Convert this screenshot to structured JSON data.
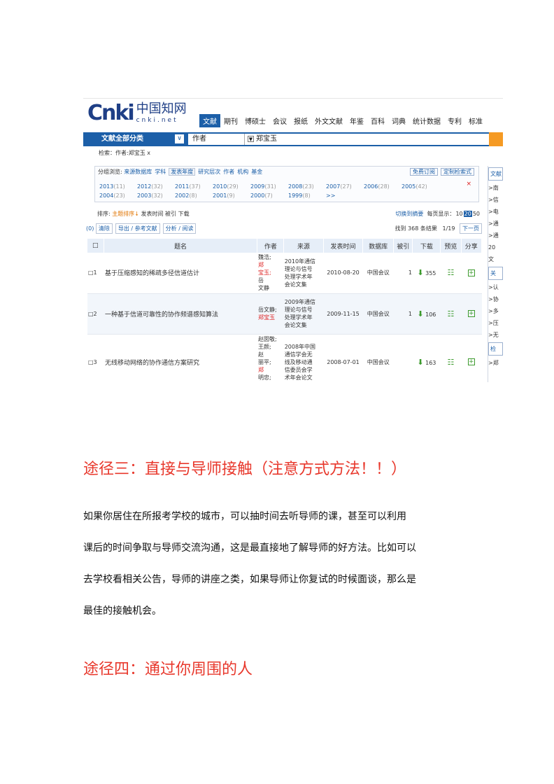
{
  "screenshot": {
    "logo": {
      "latin": "Cnki",
      "chinese": "中国知网",
      "url": "cnki.net"
    },
    "top_tabs": [
      "文献",
      "期刊",
      "博硕士",
      "会议",
      "报纸",
      "外文文献",
      "年鉴",
      "百科",
      "词典",
      "统计数据",
      "专利",
      "标准"
    ],
    "active_tab": "文献",
    "search": {
      "category": "文献全部分类",
      "field": "作者",
      "value": "郑宝玉"
    },
    "crumb": "检索：作者:郑宝玉  x",
    "group_browse": {
      "label": "分组浏览:",
      "options": [
        "来源数据库",
        "学科",
        "发表年度",
        "研究层次",
        "作者",
        "机构",
        "基金"
      ],
      "active": "发表年度",
      "right_buttons": [
        "免费订阅",
        "定制检索式"
      ]
    },
    "years_row1": [
      "2013(11)",
      "2012(32)",
      "2011(37)",
      "2010(29)",
      "2009(31)",
      "2008(23)",
      "2007(27)",
      "2006(28)",
      "2005(42)"
    ],
    "years_row2": [
      "2004(23)",
      "2003(32)",
      "2002(8)",
      "2001(9)",
      "2000(7)",
      "1999(8)",
      ">>"
    ],
    "close": "×",
    "sort": {
      "label": "排序:",
      "active": "主题排序",
      "arrow": "↓",
      "others": [
        "发表时间",
        "被引",
        "下载"
      ],
      "switch": "切换到摘要",
      "per_page_label": "每页显示：",
      "per_page": [
        "10",
        "20",
        "50"
      ],
      "per_page_active": "20"
    },
    "actions": {
      "count": "(0)",
      "buttons": [
        "清除",
        "导出 / 参考文献",
        "分析 / 阅读"
      ],
      "found": "找到 368 条结果",
      "page": "1/19",
      "next": "下一页"
    },
    "columns": [
      "题名",
      "作者",
      "来源",
      "发表时间",
      "数据库",
      "被引",
      "下载",
      "预览",
      "分享"
    ],
    "rows": [
      {
        "num": "1",
        "title": "基于压缩感知的稀疏多径信道估计",
        "authors": [
          "魏浩;",
          "郑",
          "宝玉;",
          "岳",
          "文静"
        ],
        "source": [
          "2010年通信",
          "理论与信号",
          "处理学术年",
          "会论文集"
        ],
        "date": "2010-08-20",
        "db": "中国会议",
        "cited": "1",
        "downloads": "355"
      },
      {
        "num": "2",
        "title": "一种基于信道可靠性的协作频谱感知算法",
        "authors": [
          "岳文静;",
          "郑宝玉"
        ],
        "source": [
          "2009年通信",
          "理论与信号",
          "处理学术年",
          "会论文集"
        ],
        "date": "2009-11-15",
        "db": "中国会议",
        "cited": "1",
        "downloads": "106"
      },
      {
        "num": "3",
        "title": "无线移动网络的协作通信方案研究",
        "authors": [
          "赵囡敬;",
          "王颜;",
          "赵",
          "丽平;",
          "郑",
          "明忠;",
          "郑"
        ],
        "source": [
          "2008年中国",
          "通信学会无",
          "线及移动通",
          "信委员会学",
          "术年会论文"
        ],
        "date": "2008-07-01",
        "db": "中国会议",
        "cited": "",
        "downloads": "163"
      }
    ],
    "sidebar": [
      "文献",
      ">南",
      ">信",
      ">电",
      ">通",
      ">通",
      "20",
      "文",
      "关",
      ">认",
      ">协",
      ">多",
      ">压",
      ">无",
      "检",
      ">郑"
    ]
  },
  "article": {
    "heading3": "途径三：直接与导师接触（注意方式方法！！）",
    "paragraph_lines": [
      "  如果你居住在所报考学校的城市，可以抽时间去听导师的课，甚至可以利用",
      "课后的时间争取与导师交流沟通，这是最直接地了解导师的好方法。比如可以",
      "去学校看相关公告，导师的讲座之类，如果导师让你复试的时候面谈，那么是",
      "最佳的接触机会。"
    ],
    "heading4": "途径四：通过你周围的人"
  },
  "colors": {
    "heading": "#e8382c",
    "cnki_blue": "#1c5fa8",
    "orange": "#f59a23"
  }
}
